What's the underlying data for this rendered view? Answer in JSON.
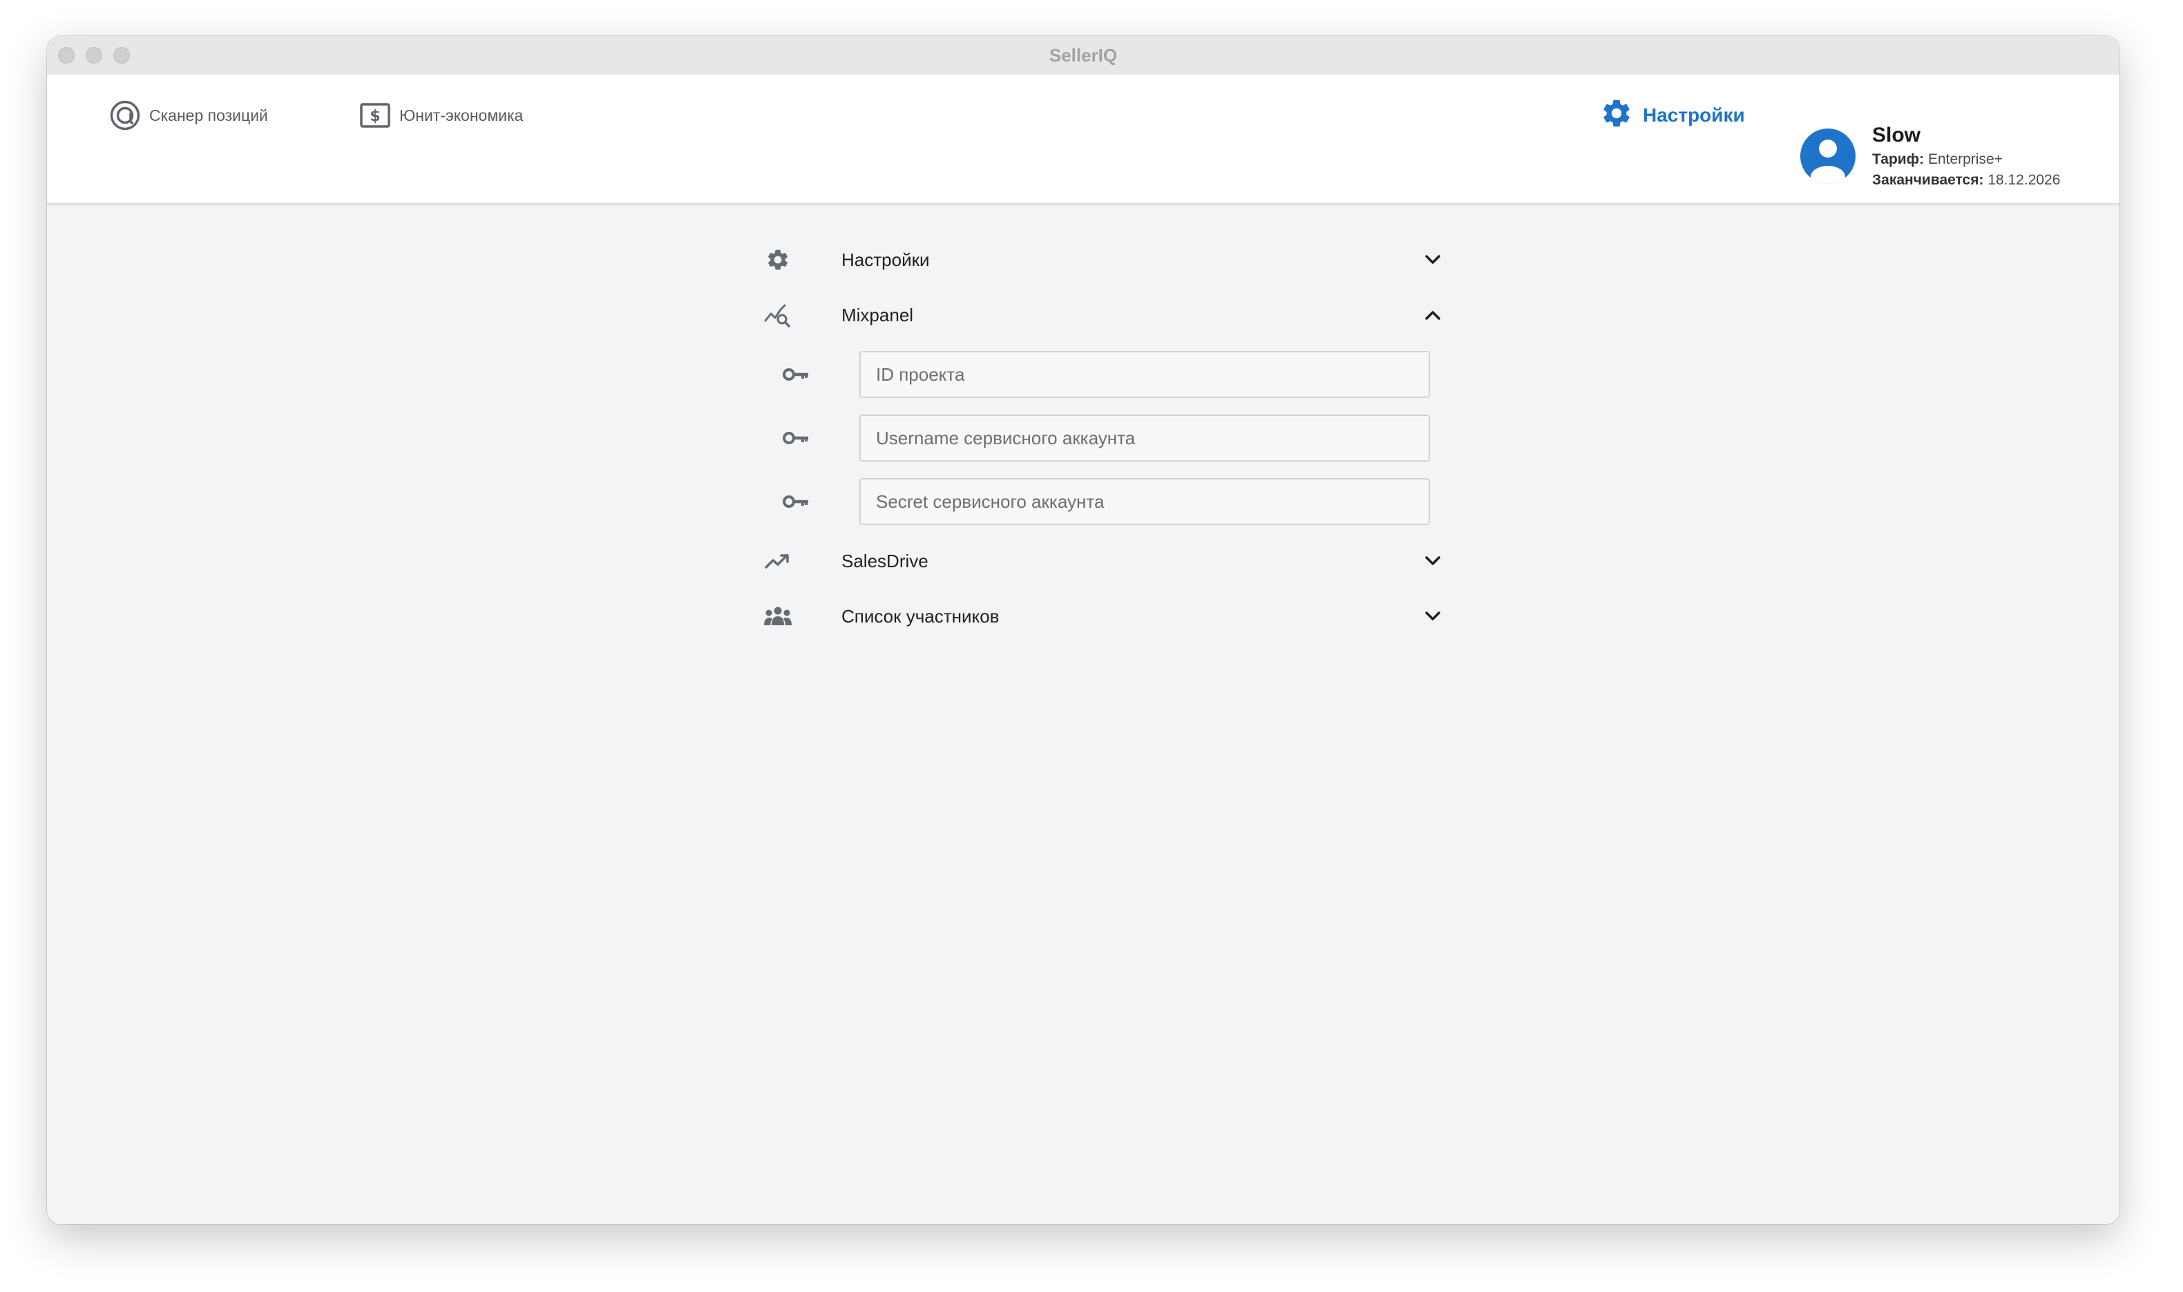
{
  "window": {
    "title": "SellerIQ"
  },
  "nav": {
    "items": [
      {
        "label": "Сканер позиций",
        "icon": "target-icon"
      },
      {
        "label": "Юнит-экономика",
        "icon": "dollar-bill-icon"
      }
    ],
    "settings_label": "Настройки"
  },
  "user": {
    "name": "Slow",
    "plan_label": "Тариф:",
    "plan_value": "Enterprise+",
    "expires_label": "Заканчивается:",
    "expires_value": "18.12.2026"
  },
  "sections": [
    {
      "label": "Настройки",
      "icon": "gear-icon",
      "expanded": false
    },
    {
      "label": "Mixpanel",
      "icon": "analytics-search-icon",
      "expanded": true
    },
    {
      "label": "SalesDrive",
      "icon": "trending-up-icon",
      "expanded": false
    },
    {
      "label": "Список участников",
      "icon": "group-icon",
      "expanded": false
    }
  ],
  "mixpanel_fields": [
    {
      "placeholder": "ID проекта",
      "value": ""
    },
    {
      "placeholder": "Username сервисного аккаунта",
      "value": ""
    },
    {
      "placeholder": "Secret сервисного аккаунта",
      "value": ""
    }
  ],
  "colors": {
    "accent": "#1f74c9",
    "background": "#f3f4f6",
    "icon_gray": "#666b72"
  }
}
